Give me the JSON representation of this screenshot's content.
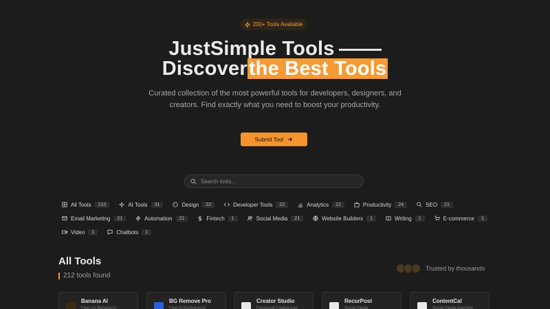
{
  "hero": {
    "badge": "200+ Tools Available",
    "title_line1": "JustSimple Tools",
    "title_line2_plain": "Discover",
    "title_line2_highlight": "the Best Tools",
    "subtitle": "Curated collection of the most powerful tools for developers, designers, and creators. Find exactly what you need to boost your productivity.",
    "submit_label": "Submit Tool"
  },
  "search": {
    "placeholder": "Search tools..."
  },
  "categories": [
    {
      "label": "All Tools",
      "count": "210",
      "icon": "grid-icon"
    },
    {
      "label": "AI Tools",
      "count": "31",
      "icon": "sparkles-icon"
    },
    {
      "label": "Design",
      "count": "22",
      "icon": "palette-icon"
    },
    {
      "label": "Developer Tools",
      "count": "22",
      "icon": "code-icon"
    },
    {
      "label": "Analytics",
      "count": "21",
      "icon": "bar-chart-icon"
    },
    {
      "label": "Productivity",
      "count": "24",
      "icon": "briefcase-icon"
    },
    {
      "label": "SEO",
      "count": "21",
      "icon": "search-icon"
    },
    {
      "label": "Email Marketing",
      "count": "21",
      "icon": "mail-icon"
    },
    {
      "label": "Automation",
      "count": "21",
      "icon": "zap-icon"
    },
    {
      "label": "Fintech",
      "count": "1",
      "icon": "dollar-icon"
    },
    {
      "label": "Social Media",
      "count": "21",
      "icon": "users-icon"
    },
    {
      "label": "Website Builders",
      "count": "1",
      "icon": "globe-icon"
    },
    {
      "label": "Writing",
      "count": "1",
      "icon": "book-icon"
    },
    {
      "label": "E-commerce",
      "count": "1",
      "icon": "cart-icon"
    },
    {
      "label": "Video",
      "count": "1",
      "icon": "video-icon"
    },
    {
      "label": "Chatbots",
      "count": "1",
      "icon": "chat-icon"
    }
  ],
  "section": {
    "title": "All Tools",
    "found": "212 tools found",
    "trusted": "Trusted by thousands"
  },
  "cards": [
    {
      "name": "Banana AI",
      "desc": "Free Up Banana AI",
      "icon_color": "#3a2a14"
    },
    {
      "name": "BG Remove Pro",
      "desc": "Free AI Background",
      "icon_color": "#2b5fd9"
    },
    {
      "name": "Creator Studio",
      "desc": "Facebook's native tool",
      "icon_color": "#e8e8e8"
    },
    {
      "name": "RecurPost",
      "desc": "Social media",
      "icon_color": "#e8e8e8"
    },
    {
      "name": "ContentCal",
      "desc": "Social media planning",
      "icon_color": "#e8e8e8"
    }
  ],
  "colors": {
    "accent": "#f5942c",
    "background": "#1c1c1c"
  }
}
